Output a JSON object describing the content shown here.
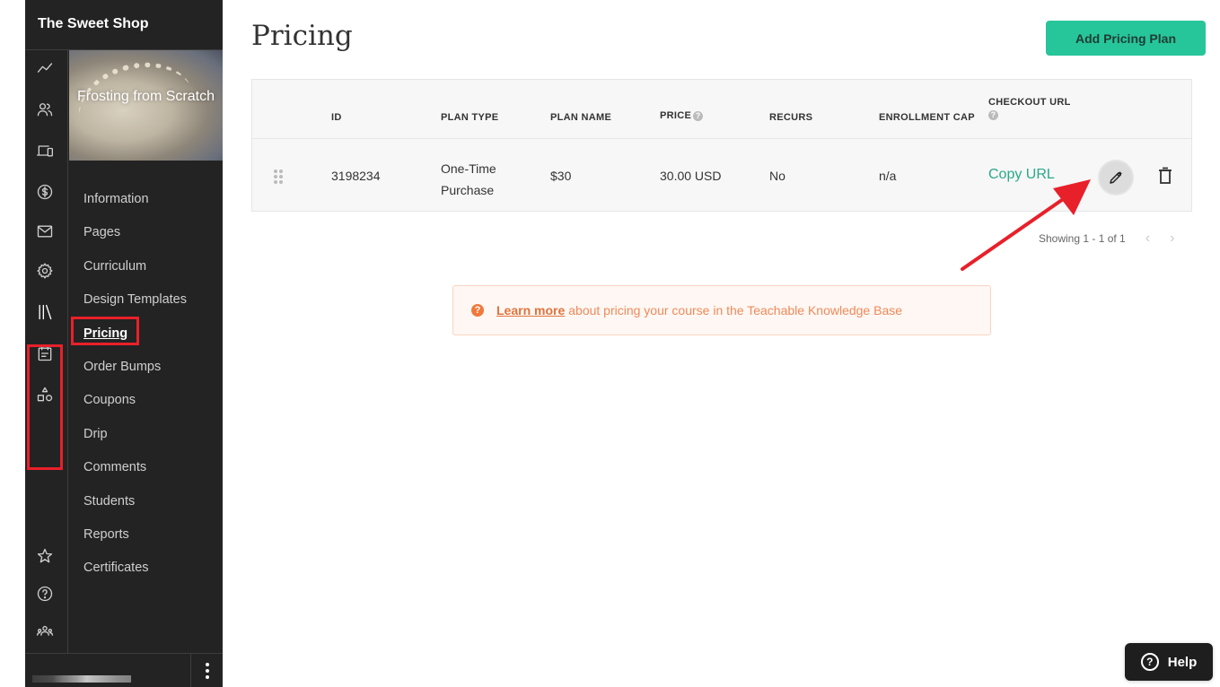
{
  "sidebar": {
    "school_name": "The Sweet Shop",
    "rail_icons": [
      {
        "name": "stats-icon"
      },
      {
        "name": "users-icon"
      },
      {
        "name": "site-icon"
      },
      {
        "name": "sales-icon"
      },
      {
        "name": "emails-icon"
      },
      {
        "name": "settings-icon"
      },
      {
        "name": "products-library-icon"
      },
      {
        "name": "calendar-icon"
      },
      {
        "name": "shapes-icon"
      },
      {
        "name": "star-icon"
      },
      {
        "name": "help-circle-icon"
      },
      {
        "name": "community-icon"
      }
    ],
    "course": {
      "title": "Frosting from Scratch"
    },
    "nav": [
      {
        "label": "Information"
      },
      {
        "label": "Pages"
      },
      {
        "label": "Curriculum"
      },
      {
        "label": "Design Templates"
      },
      {
        "label": "Pricing",
        "active": true
      },
      {
        "label": "Order Bumps"
      },
      {
        "label": "Coupons"
      },
      {
        "label": "Drip"
      },
      {
        "label": "Comments"
      },
      {
        "label": "Students"
      },
      {
        "label": "Reports"
      },
      {
        "label": "Certificates"
      }
    ]
  },
  "main": {
    "title": "Pricing",
    "add_button_label": "Add Pricing Plan",
    "table": {
      "headers": {
        "id": "ID",
        "plan_type": "PLAN TYPE",
        "plan_name": "PLAN NAME",
        "price": "PRICE",
        "recurs": "RECURS",
        "enrollment_cap": "ENROLLMENT CAP",
        "checkout_url": "CHECKOUT URL"
      },
      "rows": [
        {
          "id": "3198234",
          "plan_type_line1": "One-Time",
          "plan_type_line2": "Purchase",
          "plan_name": "$30",
          "price": "30.00 USD",
          "recurs": "No",
          "enrollment_cap": "n/a",
          "checkout_url_label": "Copy URL"
        }
      ]
    },
    "pagination": {
      "text": "Showing 1 - 1 of 1",
      "prev": "‹",
      "next": "›"
    },
    "info": {
      "icon": "?",
      "link_label": "Learn more",
      "text": "about pricing your course in the Teachable Knowledge Base"
    }
  },
  "help_button": {
    "icon": "?",
    "label": "Help"
  },
  "annotation": {
    "color": "#e8202a"
  }
}
